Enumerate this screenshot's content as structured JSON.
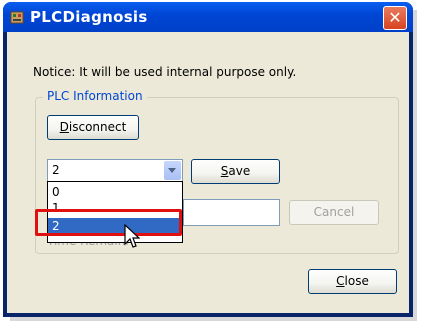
{
  "window": {
    "title": "PLCDiagnosis",
    "close_glyph": "✕",
    "app_icon": "plc-app-icon"
  },
  "notice": "Notice: It will be used internal purpose only.",
  "plc_info": {
    "group_label": "PLC Information",
    "disconnect_label_prefix": "D",
    "disconnect_label_rest": "isconnect",
    "combo_value": "2",
    "combo_options": [
      "0",
      "1",
      "2"
    ],
    "selected_index": 2,
    "save_label_prefix": "S",
    "save_label_rest": "ave",
    "cancel_label": "Cancel",
    "time_remaining_label": "Time Remaini"
  },
  "footer": {
    "close_label_prefix": "C",
    "close_label_rest": "lose"
  },
  "colors": {
    "title_bar": "#0046d5",
    "selection": "#316ac5",
    "highlight_box": "#e01010"
  }
}
